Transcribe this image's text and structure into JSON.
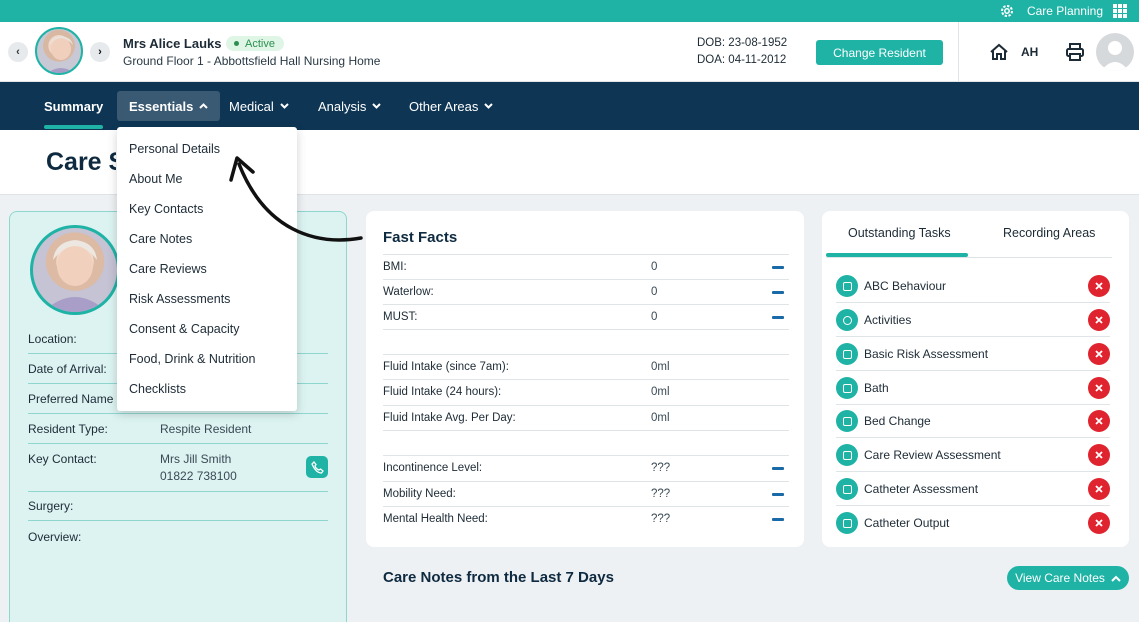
{
  "topbar": {
    "app_label": "Care Planning",
    "settings_icon": "gear-icon",
    "apps_icon": "grid-icon"
  },
  "resident": {
    "name": "Mrs Alice Lauks",
    "status": "Active",
    "location_line": "Ground Floor 1 - Abbottsfield Hall Nursing Home",
    "dob": "DOB: 23-08-1952",
    "doa": "DOA: 04-11-2012"
  },
  "header": {
    "change_resident": "Change Resident",
    "initials": "AH",
    "prev": "‹",
    "next": "›"
  },
  "nav": {
    "items": [
      "Summary",
      "Essentials",
      "Medical",
      "Analysis",
      "Other Areas"
    ],
    "active": "Summary",
    "open_menu": "Essentials"
  },
  "page": {
    "title": "Care S"
  },
  "essentials_menu": [
    "Personal Details",
    "About Me",
    "Key Contacts",
    "Care Notes",
    "Care Reviews",
    "Risk Assessments",
    "Consent & Capacity",
    "Food, Drink & Nutrition",
    "Checklists"
  ],
  "resident_card": {
    "rows": [
      {
        "label": "Location:",
        "value": ""
      },
      {
        "label": "Date of Arrival:",
        "value": ""
      },
      {
        "label": "Preferred Name",
        "value": ""
      },
      {
        "label": "Resident Type:",
        "value": "Respite Resident"
      },
      {
        "label": "Key Contact:",
        "value": "Mrs Jill Smith",
        "value2": "01822 738100"
      },
      {
        "label": "Surgery:",
        "value": ""
      },
      {
        "label": "Overview:",
        "value": ""
      }
    ]
  },
  "fast_facts": {
    "title": "Fast Facts",
    "rows": [
      {
        "label": "BMI:",
        "value": "0",
        "dash": true
      },
      {
        "label": "Waterlow:",
        "value": "0",
        "dash": true
      },
      {
        "label": "MUST:",
        "value": "0",
        "dash": true
      },
      {
        "label": "Fluid Intake (since 7am):",
        "value": "0ml",
        "dash": false
      },
      {
        "label": "Fluid Intake (24 hours):",
        "value": "0ml",
        "dash": false
      },
      {
        "label": "Fluid Intake Avg. Per Day:",
        "value": "0ml",
        "dash": false
      },
      {
        "label": "Incontinence Level:",
        "value": "???",
        "dash": true
      },
      {
        "label": "Mobility Need:",
        "value": "???",
        "dash": true
      },
      {
        "label": "Mental Health Need:",
        "value": "???",
        "dash": true
      }
    ]
  },
  "tasks": {
    "tabs": [
      "Outstanding Tasks",
      "Recording Areas"
    ],
    "active_tab": "Outstanding Tasks",
    "items": [
      "ABC Behaviour",
      "Activities",
      "Basic Risk Assessment",
      "Bath",
      "Bed Change",
      "Care Review Assessment",
      "Catheter Assessment",
      "Catheter Output"
    ]
  },
  "care_notes": {
    "title": "Care Notes from the Last 7 Days",
    "view_button": "View Care Notes"
  },
  "colors": {
    "teal": "#1fb3a6",
    "navy": "#0e3654",
    "danger": "#e0242f",
    "active_green": "#2c8f4f"
  }
}
